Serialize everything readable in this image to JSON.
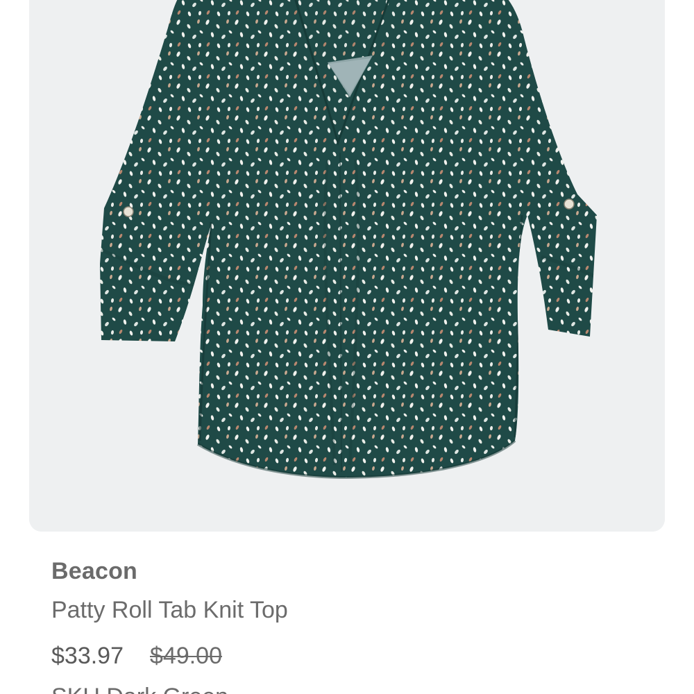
{
  "product": {
    "image_alt": "Green speckled roll tab knit top",
    "brand": "Beacon",
    "name": "Patty Roll Tab Knit Top",
    "sale_price": "$33.97",
    "original_price": "$49.00",
    "color_line": "SKU Dark Green"
  },
  "colors": {
    "card_background": "#eef0f1",
    "garment": "#1f4a47",
    "text": "#6b6b6b"
  }
}
